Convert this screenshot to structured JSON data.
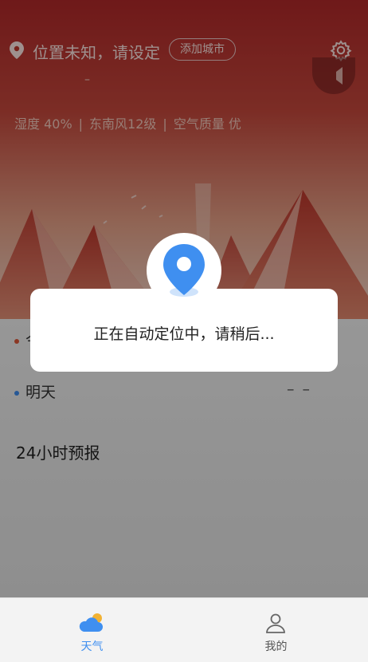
{
  "header": {
    "location_text": "位置未知，请设定",
    "add_city_label": "添加城市",
    "temp_placeholder": "–"
  },
  "weather_meta": {
    "humidity": "湿度 40%",
    "wind": "东南风12级",
    "air_quality": "空气质量  优",
    "separator": "|"
  },
  "forecast": {
    "today_label": "今",
    "tomorrow_label": "明天",
    "tomorrow_value": "– –",
    "hourly_title": "24小时预报"
  },
  "dialog": {
    "message": "正在自动定位中，请稍后..."
  },
  "tabs": [
    {
      "label": "天气",
      "active": true
    },
    {
      "label": "我的",
      "active": false
    }
  ],
  "colors": {
    "accent_blue": "#3f8ff0",
    "tab_inactive": "#555555",
    "today_dot": "#e05a3a",
    "tomorrow_dot": "#3f8ff0"
  },
  "icons": {
    "location": "location-pin-icon",
    "settings": "gear-icon",
    "speaker": "speaker-icon",
    "dialog": "map-pin-icon",
    "tab_weather": "cloud-sun-icon",
    "tab_mine": "user-icon"
  }
}
